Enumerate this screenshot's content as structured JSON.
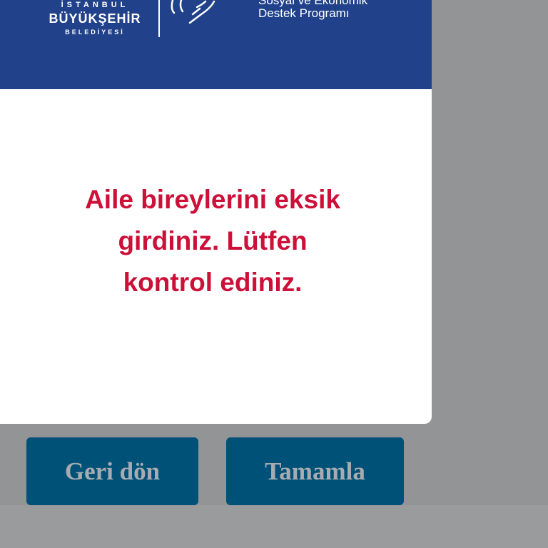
{
  "header": {
    "logo": {
      "line1": "İSTANBUL",
      "line2": "BÜYÜKŞEHİR",
      "line3": "BELEDİYESİ"
    },
    "program_title_top": "Sosyal ve Ekonomik",
    "program_title_bottom": "Destek Programı",
    "icon": "hand-icon"
  },
  "dialog": {
    "message": "Aile bireylerini eksik girdiniz. Lütfen kontrol ediniz."
  },
  "buttons": {
    "back_label": "Geri dön",
    "complete_label": "Tamamla"
  },
  "colors": {
    "header_bg": "#21428a",
    "message_text": "#cc1038",
    "button_bg": "#005178",
    "button_text": "#a8acb0",
    "overlay": "#939496"
  }
}
